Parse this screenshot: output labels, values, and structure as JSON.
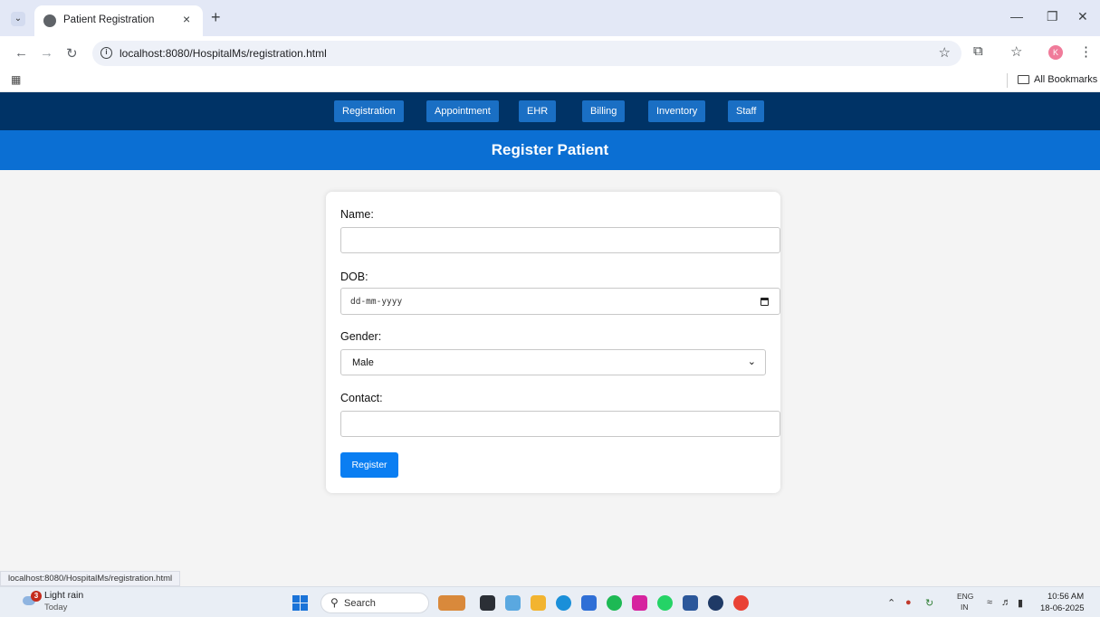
{
  "browser": {
    "tab_title": "Patient Registration",
    "url": "localhost:8080/HospitalMs/registration.html",
    "all_bookmarks_label": "All Bookmarks",
    "profile_initial": "K",
    "status_url": "localhost:8080/HospitalMs/registration.html"
  },
  "nav": {
    "items": [
      "Registration",
      "Appointment",
      "EHR",
      "Billing",
      "Inventory",
      "Staff"
    ]
  },
  "header": {
    "title": "Register Patient"
  },
  "form": {
    "name_label": "Name:",
    "name_value": "",
    "dob_label": "DOB:",
    "dob_placeholder": "dd-mm-yyyy",
    "gender_label": "Gender:",
    "gender_selected": "Male",
    "contact_label": "Contact:",
    "contact_value": "",
    "submit_label": "Register"
  },
  "taskbar": {
    "weather_badge": "3",
    "weather_title": "Light rain",
    "weather_sub": "Today",
    "search_label": "Search",
    "lang_top": "ENG",
    "lang_bottom": "IN",
    "time": "10:56 AM",
    "date": "18-06-2025"
  },
  "colors": {
    "nav_bar": "#003366",
    "nav_button": "#1a6fc4",
    "banner": "#0b6fd3",
    "submit_button": "#0a7ef2"
  }
}
